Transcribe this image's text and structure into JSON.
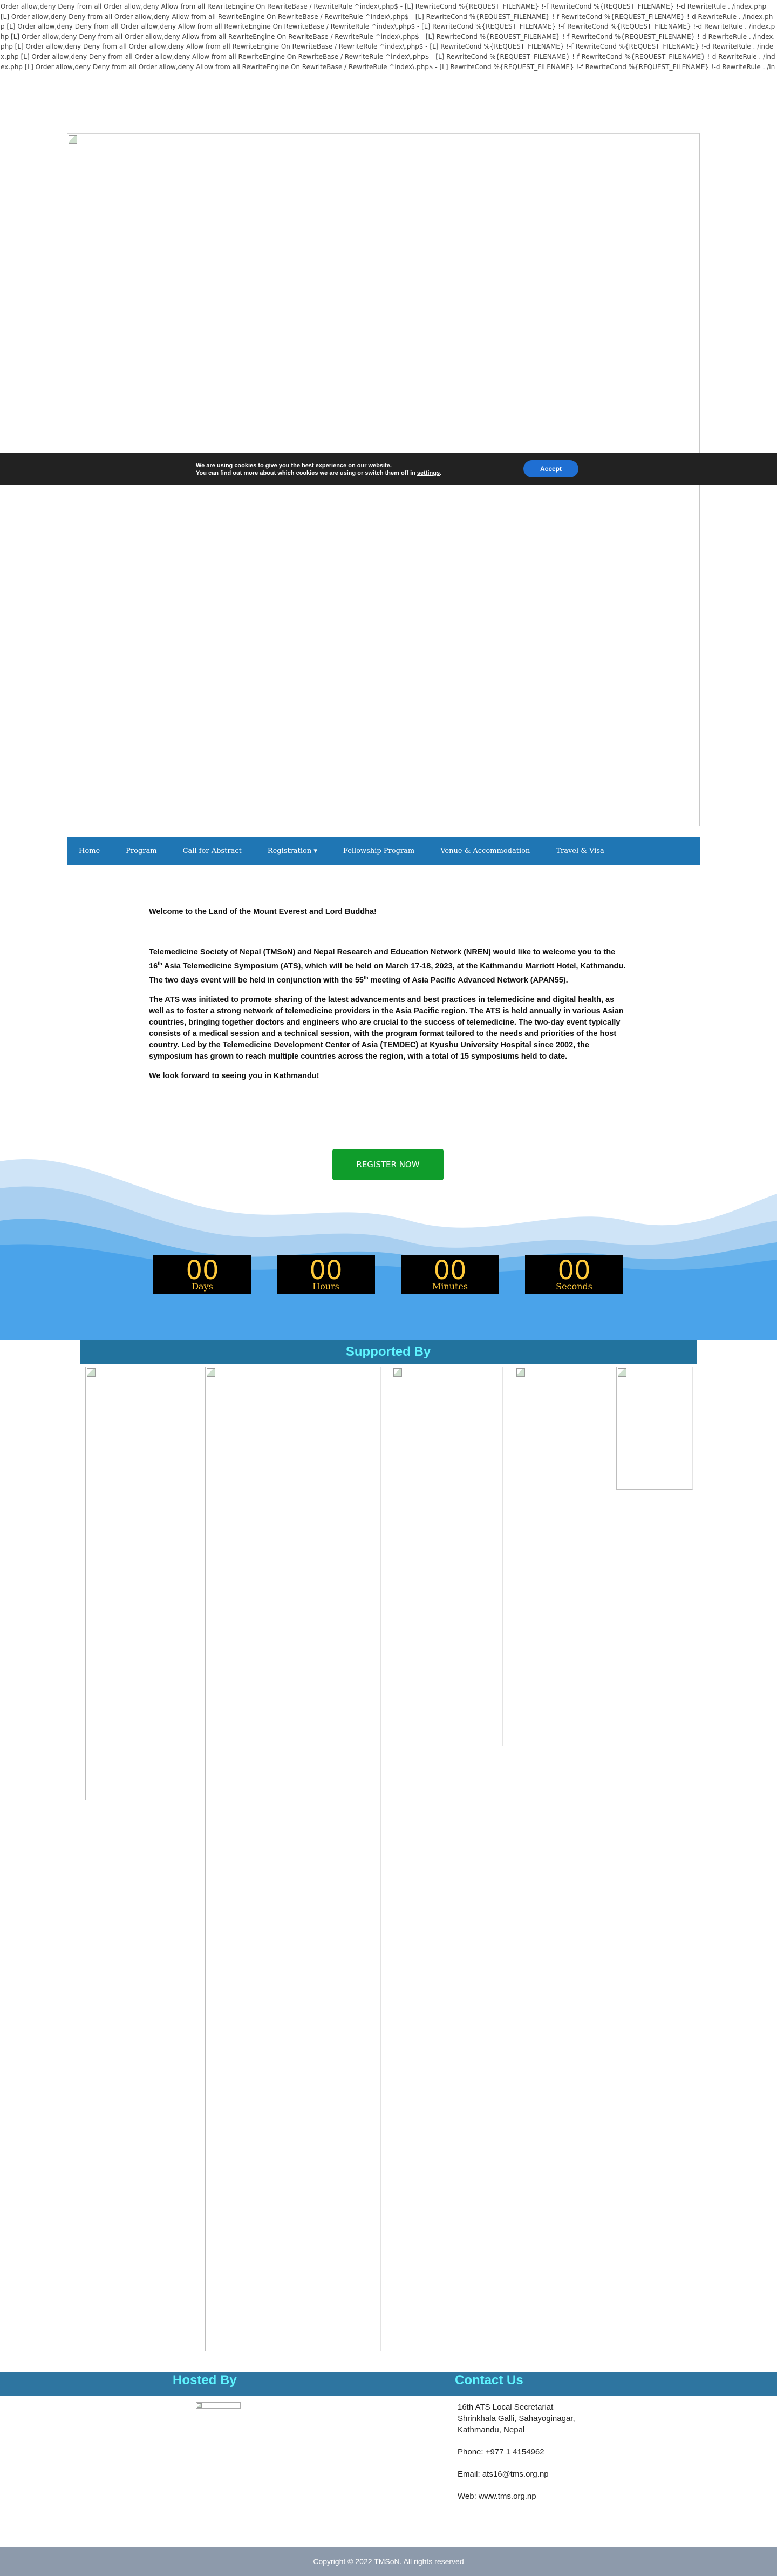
{
  "htaccess_dump": "Order allow,deny Deny from all Order allow,deny Allow from all RewriteEngine On RewriteBase / RewriteRule ^index\\.php$ - [L] RewriteCond %{REQUEST_FILENAME} !-f RewriteCond %{REQUEST_FILENAME} !-d RewriteRule . /index.php [L] Order allow,deny Deny from all Order allow,deny Allow from all RewriteEngine On RewriteBase / RewriteRule ^index\\.php$ - [L] RewriteCond %{REQUEST_FILENAME} !-f RewriteCond %{REQUEST_FILENAME} !-d RewriteRule . /index.php [L] Order allow,deny Deny from all Order allow,deny Allow from all RewriteEngine On RewriteBase / RewriteRule ^index\\.php$ - [L] RewriteCond %{REQUEST_FILENAME} !-f RewriteCond %{REQUEST_FILENAME} !-d RewriteRule . /index.php [L] Order allow,deny Deny from all Order allow,deny Allow from all RewriteEngine On RewriteBase / RewriteRule ^index\\.php$ - [L] RewriteCond %{REQUEST_FILENAME} !-f RewriteCond %{REQUEST_FILENAME} !-d RewriteRule . /index.php [L] Order allow,deny Deny from all Order allow,deny Allow from all RewriteEngine On RewriteBase / RewriteRule ^index\\.php$ - [L] RewriteCond %{REQUEST_FILENAME} !-f RewriteCond %{REQUEST_FILENAME} !-d RewriteRule . /index.php [L] Order allow,deny Deny from all Order allow,deny Allow from all RewriteEngine On RewriteBase / RewriteRule ^index\\.php$ - [L] RewriteCond %{REQUEST_FILENAME} !-f RewriteCond %{REQUEST_FILENAME} !-d RewriteRule . /index.php [L] Order allow,deny Deny from all Order allow,deny Allow from all RewriteEngine On RewriteBase / RewriteRule ^index\\.php$ - [L] RewriteCond %{REQUEST_FILENAME} !-f RewriteCond %{REQUEST_FILENAME} !-d RewriteRule . /index.php [L]",
  "cookie": {
    "line1": "We are using cookies to give you the best experience on our website.",
    "line2_prefix": "You can find out more about which cookies we are using or switch them off in ",
    "settings_link": "settings",
    "line2_suffix": ".",
    "accept_label": "Accept"
  },
  "nav": {
    "items": [
      {
        "label": "Home"
      },
      {
        "label": "Program"
      },
      {
        "label": "Call for Abstract"
      },
      {
        "label": "Registration"
      },
      {
        "label": "Fellowship Program"
      },
      {
        "label": "Venue & Accommodation"
      },
      {
        "label": "Travel & Visa"
      }
    ],
    "dropdown_glyph": "▾"
  },
  "welcome": {
    "heading": "Welcome to the Land of the Mount Everest and Lord Buddha!",
    "p1_a": "Telemedicine Society of Nepal (TMSoN) and Nepal Research and Education Network (NREN) would like to welcome you to the 16",
    "p1_sup1": "th",
    "p1_b": " Asia Telemedicine Symposium (ATS), which will be held on March 17-18, 2023, at the Kathmandu Marriott Hotel, Kathmandu. The two days event will be held in conjunction with the 55",
    "p1_sup2": "th",
    "p1_c": " meeting of Asia Pacific Advanced Network (APAN55).",
    "p2": "The ATS was initiated to promote sharing of the latest advancements and best practices in telemedicine and digital health, as well as to foster a strong network of telemedicine providers in the Asia Pacific region. The ATS is held annually in various Asian countries, bringing together doctors and engineers who are crucial to the success of telemedicine. The two-day event typically consists of a medical session and a technical session, with the program format tailored to the needs and priorities of the host country. Led by the Telemedicine Development Center of Asia (TEMDEC) at Kyushu University Hospital since 2002, the symposium has grown to reach multiple countries across the region, with a total of 15 symposiums held to date.",
    "p3": "We look forward to seeing you in Kathmandu!"
  },
  "register_label": "REGISTER NOW",
  "countdown": [
    {
      "value": "00",
      "label": "Days"
    },
    {
      "value": "00",
      "label": "Hours"
    },
    {
      "value": "00",
      "label": "Minutes"
    },
    {
      "value": "00",
      "label": "Seconds"
    }
  ],
  "supported_by": "Supported By",
  "hosted_by": "Hosted By",
  "contact_us": "Contact Us",
  "contact": {
    "line1": "16th ATS Local Secretariat",
    "line2": "Shrinkhala Galli, Sahayoginagar,",
    "line3": "Kathmandu, Nepal",
    "phone": "Phone: +977 1 4154962",
    "email": "Email: ats16@tms.org.np",
    "web": "Web: www.tms.org.np"
  },
  "copyright": "Copyright © 2022 TMSoN. All rights reserved",
  "colors": {
    "nav_bg": "#1f76b4",
    "register_bg": "#0f9d2b",
    "countdown_digits": "#ffc93a",
    "section_heading": "#5ff4ff",
    "wave_blue": "#4aa3ea"
  }
}
